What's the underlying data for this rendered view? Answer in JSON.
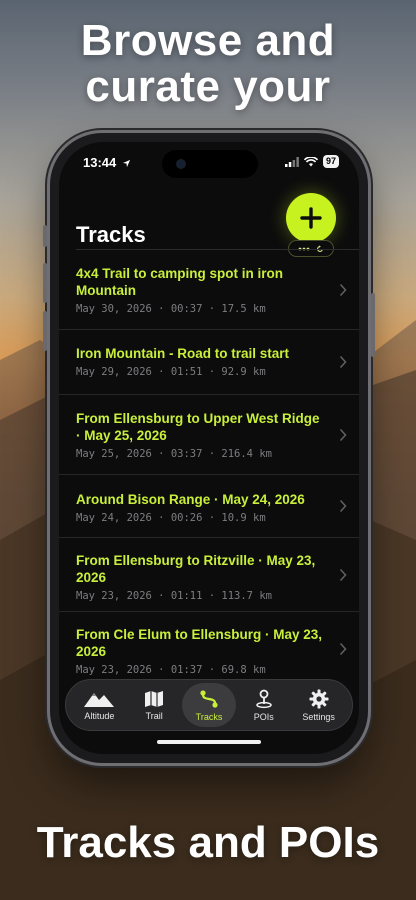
{
  "marketing": {
    "headline_top_line1": "Browse and",
    "headline_top_line2": "curate your",
    "headline_bottom": "Tracks and POIs"
  },
  "status_bar": {
    "time": "13:44",
    "battery": "97"
  },
  "screen": {
    "title": "Tracks",
    "add_button_icon": "plus-icon",
    "menu_pill_icons": [
      "ellipsis-icon",
      "refresh-icon"
    ],
    "accent_color": "#c8f21f"
  },
  "tracks": [
    {
      "name": "4x4 Trail to camping spot in iron Mountain",
      "meta": "May 30, 2026 · 00:37 · 17.5 km"
    },
    {
      "name": "Iron Mountain - Road to trail start",
      "meta": "May 29, 2026 · 01:51 · 92.9 km"
    },
    {
      "name": "From Ellensburg to Upper West Ridge · May 25, 2026",
      "meta": "May 25, 2026 · 03:37 · 216.4 km"
    },
    {
      "name": "Around Bison Range · May 24, 2026",
      "meta": "May 24, 2026 · 00:26 · 10.9 km"
    },
    {
      "name": "From Ellensburg to Ritzville · May 23, 2026",
      "meta": "May 23, 2026 · 01:11 · 113.7 km"
    },
    {
      "name": "From Cle Elum to Ellensburg · May 23, 2026",
      "meta": "May 23, 2026 · 01:37 · 69.8 km"
    }
  ],
  "tabbar": {
    "tabs": [
      {
        "label": "Altitude",
        "icon": "mountain-icon",
        "active": false
      },
      {
        "label": "Trail",
        "icon": "map-icon",
        "active": false
      },
      {
        "label": "Tracks",
        "icon": "route-icon",
        "active": true
      },
      {
        "label": "POIs",
        "icon": "pin-icon",
        "active": false
      },
      {
        "label": "Settings",
        "icon": "gear-icon",
        "active": false
      }
    ]
  }
}
